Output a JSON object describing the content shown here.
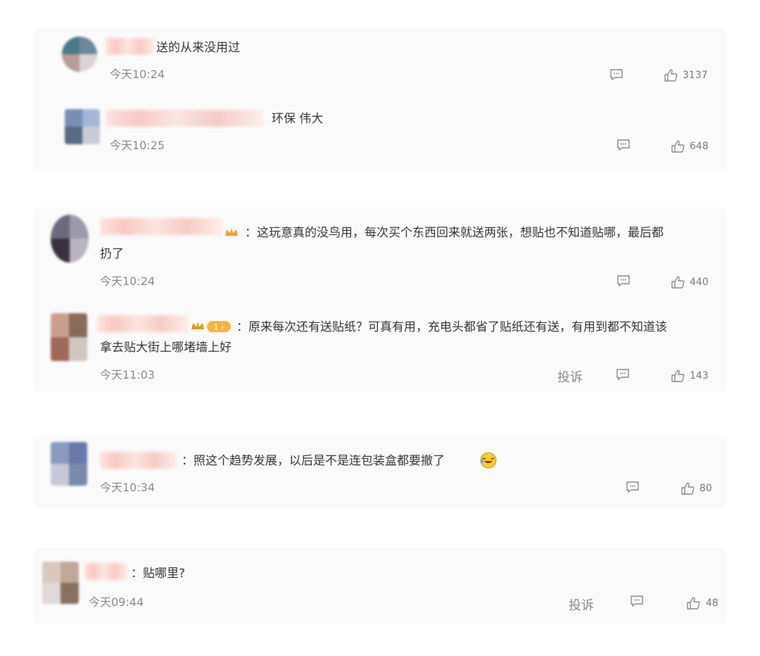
{
  "comments": [
    {
      "text": "送的从来没用过",
      "time": "今天10:24",
      "likes": "3137"
    },
    {
      "text": "环保 伟大",
      "time": "今天10:25",
      "likes": "648"
    },
    {
      "text_line1": "：这玩意真的没鸟用，每次买个东西回来就送两张，想贴也不知道贴哪，最后都",
      "text_line2": "扔了",
      "time": "今天10:24",
      "likes": "440"
    },
    {
      "text_line1": "：原来每次还有送贴纸？可真有用，充电头都省了贴纸还有送，有用到都不知道该",
      "text_line2": "拿去贴大街上哪堵墙上好",
      "time": "今天11:03",
      "likes": "143",
      "report": "投诉"
    },
    {
      "text": "：照这个趋势发展，以后是不是连包装盒都要撤了",
      "time": "今天10:34",
      "likes": "80"
    },
    {
      "text": "：贴哪里?",
      "time": "今天09:44",
      "likes": "48",
      "report": "投诉"
    }
  ],
  "icons": {
    "comment": "comment-icon",
    "like": "thumbs-up-icon"
  },
  "colors": {
    "card_bg": "#fafafa",
    "time": "#888888",
    "text": "#333333"
  }
}
